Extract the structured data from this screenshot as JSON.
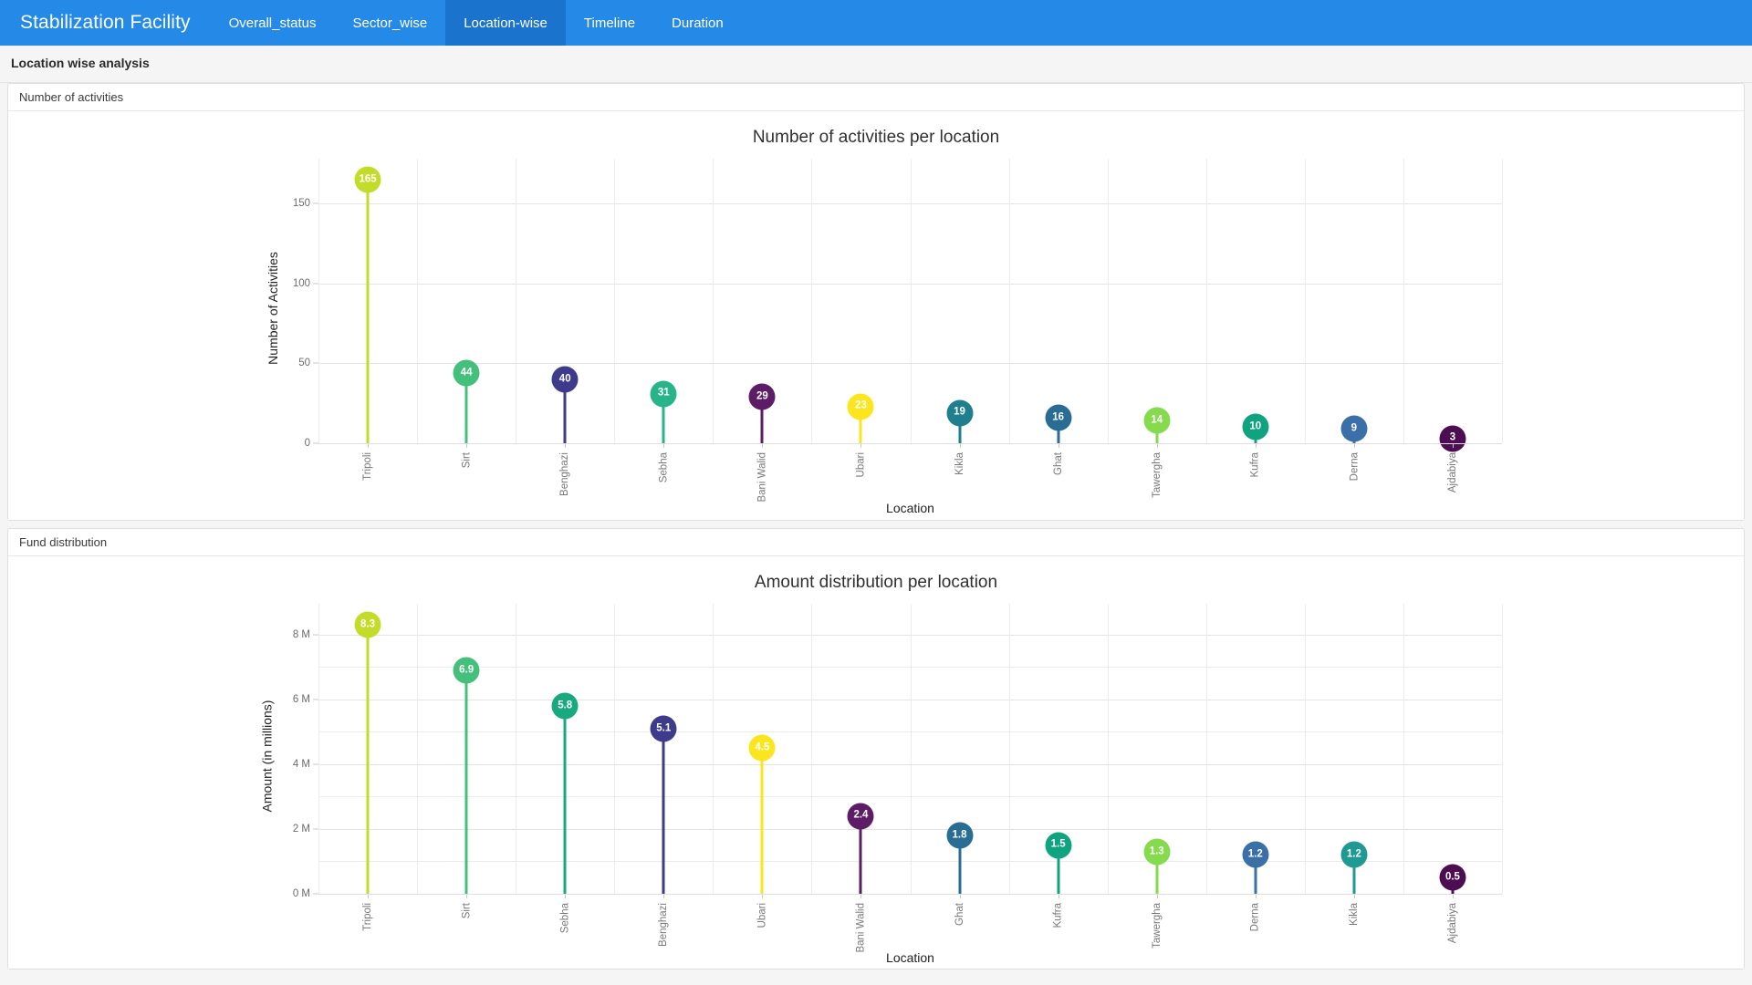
{
  "navbar": {
    "brand": "Stabilization Facility",
    "tabs": [
      {
        "label": "Overall_status",
        "active": false
      },
      {
        "label": "Sector_wise",
        "active": false
      },
      {
        "label": "Location-wise",
        "active": true
      },
      {
        "label": "Timeline",
        "active": false
      },
      {
        "label": "Duration",
        "active": false
      }
    ],
    "background": "#2489e7",
    "active_background": "#1a73cc"
  },
  "page": {
    "heading": "Location wise analysis"
  },
  "panels": [
    {
      "header": "Number of activities"
    },
    {
      "header": "Fund distribution"
    }
  ],
  "chart_data": [
    {
      "type": "bar",
      "variant": "lollipop",
      "title": "Number of activities per location",
      "xlabel": "Location",
      "ylabel": "Number of Activities",
      "categories": [
        "Tripoli",
        "Sirt",
        "Benghazi",
        "Sebha",
        "Bani Walid",
        "Ubari",
        "Kikla",
        "Ghat",
        "Tawergha",
        "Kufra",
        "Derna",
        "Ajdabiya"
      ],
      "values": [
        165,
        44,
        40,
        31,
        29,
        23,
        19,
        16,
        14,
        10,
        9,
        3
      ],
      "labels": [
        "165",
        "44",
        "40",
        "31",
        "29",
        "23",
        "19",
        "16",
        "14",
        "10",
        "9",
        "3"
      ],
      "colors": [
        "#c3dc2a",
        "#45c07c",
        "#3e3a8c",
        "#28b489",
        "#5c1c66",
        "#fbe51f",
        "#1f7f8e",
        "#2a6d94",
        "#85da4e",
        "#10a37f",
        "#3a6fa8",
        "#4d0d52"
      ],
      "yticks": [
        0,
        50,
        100,
        150
      ],
      "ytick_labels": [
        "0",
        "50",
        "100",
        "150"
      ],
      "ylim": [
        0,
        178
      ],
      "grid": true,
      "legend": "none"
    },
    {
      "type": "bar",
      "variant": "lollipop",
      "title": "Amount distribution per location",
      "xlabel": "Location",
      "ylabel": "Amount (in millions)",
      "categories": [
        "Tripoli",
        "Sirt",
        "Sebha",
        "Benghazi",
        "Ubari",
        "Bani Walid",
        "Ghat",
        "Kufra",
        "Tawergha",
        "Derna",
        "Kikla",
        "Ajdabiya"
      ],
      "values": [
        8.3,
        6.9,
        5.8,
        5.1,
        4.5,
        2.4,
        1.8,
        1.5,
        1.3,
        1.2,
        1.2,
        0.5
      ],
      "labels": [
        "8.3",
        "6.9",
        "5.8",
        "5.1",
        "4.5",
        "2.4",
        "1.8",
        "1.5",
        "1.3",
        "1.2",
        "1.2",
        "0.5"
      ],
      "colors": [
        "#c3dc2a",
        "#45c07c",
        "#18a97f",
        "#3e3a8c",
        "#fbe51f",
        "#5c1c66",
        "#2a6d94",
        "#10a37f",
        "#85da4e",
        "#3a6fa8",
        "#1f9a92",
        "#4d0d52"
      ],
      "yticks": [
        0,
        2,
        4,
        6,
        8
      ],
      "ytick_labels": [
        "0 M",
        "2 M",
        "4 M",
        "6 M",
        "8 M"
      ],
      "minor_yticks": [
        1,
        3,
        5,
        7,
        9
      ],
      "ylim": [
        0,
        8.95
      ],
      "grid": true,
      "legend": "none"
    }
  ]
}
